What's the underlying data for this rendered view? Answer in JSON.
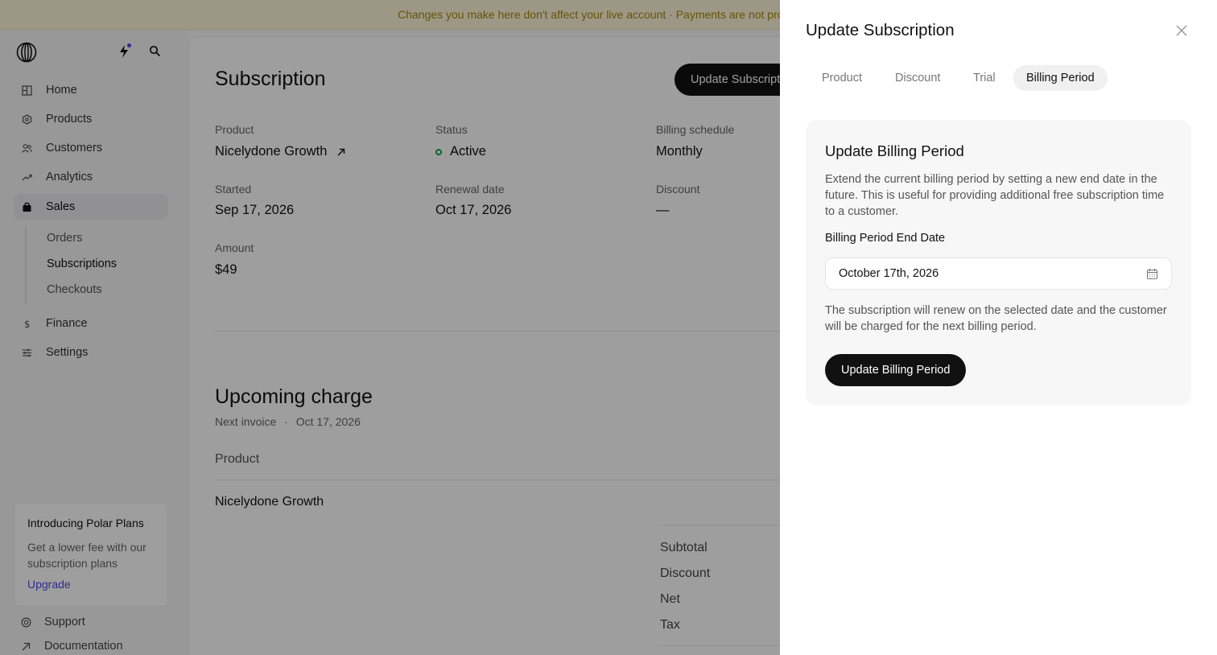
{
  "banner": {
    "text": "Changes you make here don't affect your live account · Payments are not processed"
  },
  "sidebar": {
    "items": [
      {
        "label": "Home",
        "icon": "grid-icon"
      },
      {
        "label": "Products",
        "icon": "hexagon-icon"
      },
      {
        "label": "Customers",
        "icon": "users-icon"
      },
      {
        "label": "Analytics",
        "icon": "trend-icon"
      },
      {
        "label": "Sales",
        "icon": "bag-icon",
        "active": true
      },
      {
        "label": "Finance",
        "icon": "dollar-icon"
      },
      {
        "label": "Settings",
        "icon": "sliders-icon"
      }
    ],
    "sub_items": [
      "Orders",
      "Subscriptions",
      "Checkouts"
    ],
    "active_sub": "Subscriptions",
    "promo": {
      "title": "Introducing Polar Plans",
      "text": "Get a lower fee with our subscription plans",
      "link": "Upgrade"
    },
    "footer": [
      "Support",
      "Documentation"
    ]
  },
  "main": {
    "title": "Subscription",
    "update_button": "Update Subscription",
    "fields": {
      "product_label": "Product",
      "product_value": "Nicelydone Growth",
      "status_label": "Status",
      "status_value": "Active",
      "billing_label": "Billing schedule",
      "billing_value": "Monthly",
      "started_label": "Started",
      "started_value": "Sep 17, 2026",
      "renewal_label": "Renewal date",
      "renewal_value": "Oct 17, 2026",
      "discount_label": "Discount",
      "discount_value": "—",
      "amount_label": "Amount",
      "amount_value": "$49"
    },
    "upcoming": {
      "title": "Upcoming charge",
      "next_invoice": "Next invoice",
      "next_invoice_date": "Oct 17, 2026",
      "column_product": "Product",
      "row_product": "Nicelydone Growth",
      "summary": [
        "Subtotal",
        "Discount",
        "Net",
        "Tax"
      ]
    }
  },
  "drawer": {
    "title": "Update Subscription",
    "tabs": [
      "Product",
      "Discount",
      "Trial",
      "Billing Period"
    ],
    "active_tab": "Billing Period",
    "card": {
      "title": "Update Billing Period",
      "description": "Extend the current billing period by setting a new end date in the future. This is useful for providing additional free subscription time to a customer.",
      "date_label": "Billing Period End Date",
      "date_value": "October 17th, 2026",
      "note": "The subscription will renew on the selected date and the customer will be charged for the next billing period.",
      "button": "Update Billing Period"
    }
  },
  "colors": {
    "banner_text": "#a9870a",
    "status": "#16a34a",
    "accent": "#4f46e5"
  }
}
